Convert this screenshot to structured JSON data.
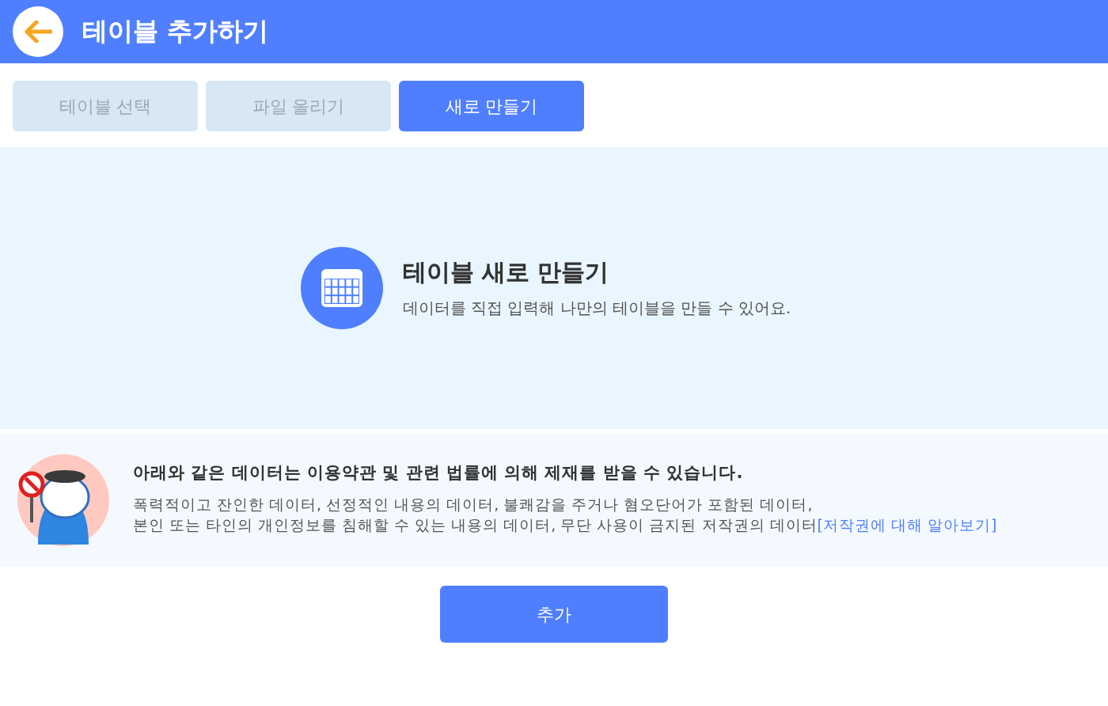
{
  "header": {
    "title": "테이블 추가하기"
  },
  "tabs": [
    {
      "label": "테이블 선택",
      "selected": false
    },
    {
      "label": "파일 올리기",
      "selected": false
    },
    {
      "label": "새로 만들기",
      "selected": true
    }
  ],
  "create": {
    "title": "테이블 새로 만들기",
    "description": "데이터를 직접 입력해 나만의 테이블을 만들 수 있어요."
  },
  "notice": {
    "title": "아래와 같은 데이터는 이용약관 및 관련 법률에 의해 제재를 받을 수 있습니다.",
    "lines": [
      "폭력적이고 잔인한 데이터, 선정적인 내용의 데이터, 불쾌감을 주거나 혐오단어가 포함된 데이터,",
      "본인 또는 타인의 개인정보를 침해할 수 있는 내용의 데이터, 무단 사용이 금지된 저작권의 데이터"
    ],
    "link": "[저작권에 대해 알아보기]"
  },
  "button": "추가"
}
